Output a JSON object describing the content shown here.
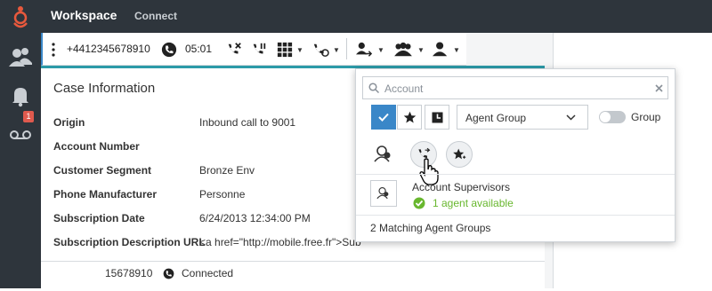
{
  "app": {
    "title": "Workspace",
    "active_tab": "Connect"
  },
  "sidebar": {
    "items": [
      {
        "icon": "contacts-icon"
      },
      {
        "icon": "bell-icon",
        "badge": "1"
      },
      {
        "icon": "voicemail-icon"
      }
    ]
  },
  "call": {
    "number": "+4412345678910",
    "duration": "05:01"
  },
  "case": {
    "title": "Case Information",
    "rows": [
      {
        "label": "Origin",
        "value": "Inbound call to 9001"
      },
      {
        "label": "Account Number",
        "value": ""
      },
      {
        "label": "Customer Segment",
        "value": "Bronze Env"
      },
      {
        "label": "Phone Manufacturer",
        "value": "Personne"
      },
      {
        "label": "Subscription Date",
        "value": "6/24/2013 12:34:00 PM"
      },
      {
        "label": "Subscription Description URL",
        "value": "<a href=\"http://mobile.free.fr\">Sub"
      }
    ]
  },
  "bottom": {
    "number_fragment": "15678910",
    "status": "Connected"
  },
  "popup": {
    "search_placeholder": "Account",
    "filter_select": "Agent Group",
    "toggle_label": "Group",
    "result": {
      "name": "Account Supervisors",
      "status": "1 agent available"
    },
    "footer": "2 Matching Agent Groups"
  },
  "colors": {
    "accent": "#3a87c8",
    "teal": "#2b9aa8",
    "available": "#68b72e",
    "dark_bg": "#2e353c"
  }
}
